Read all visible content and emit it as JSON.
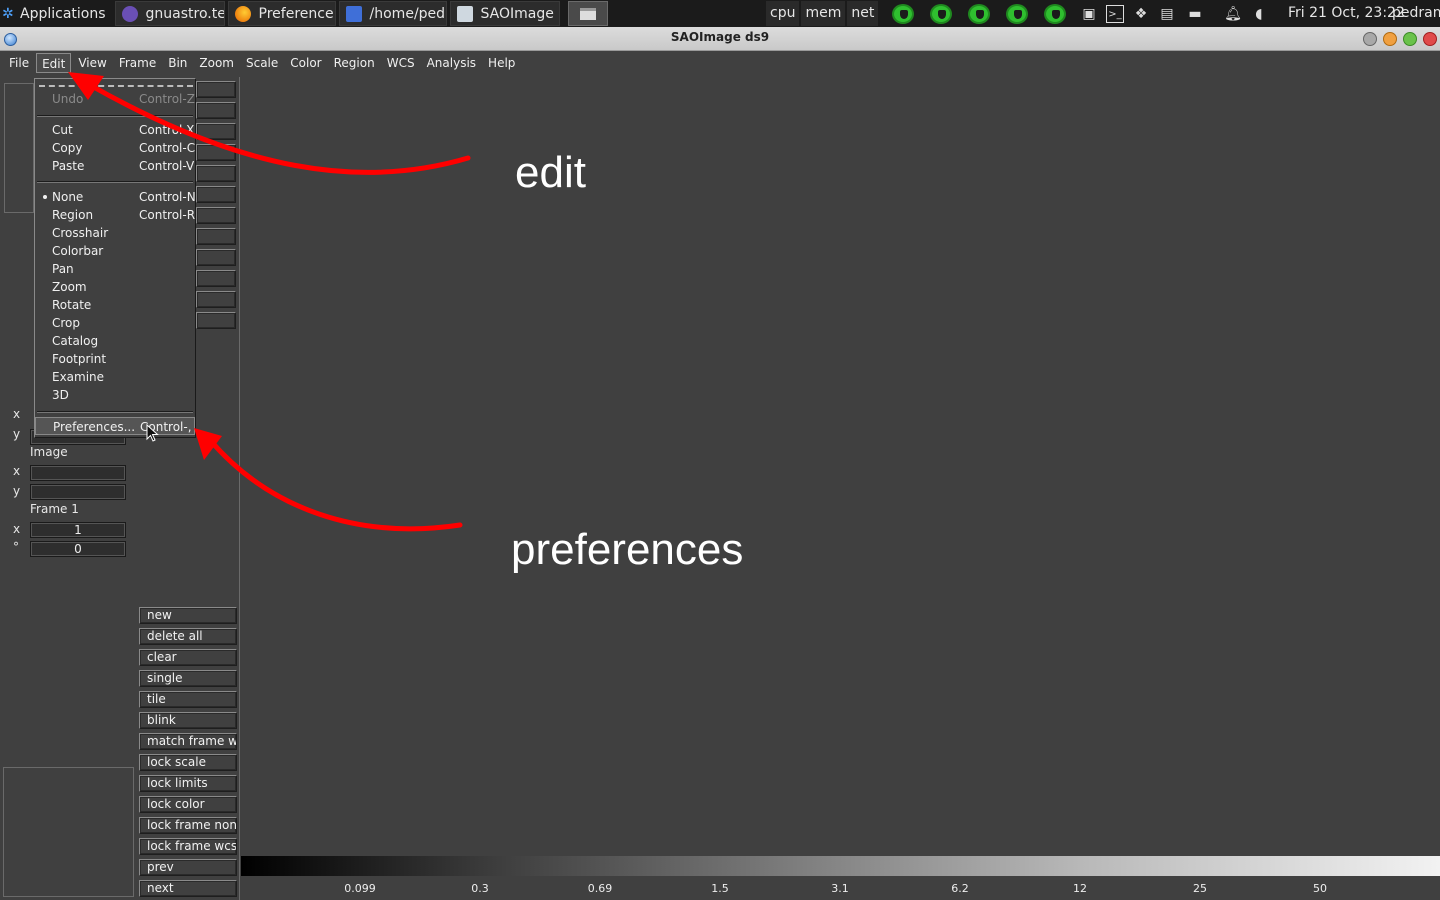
{
  "panel": {
    "applications": "Applications",
    "tasks": [
      {
        "label": "gnuastro.te...",
        "color": "#6a4fb5"
      },
      {
        "label": "Preference...",
        "color": "#e66000"
      },
      {
        "label": "/home/ped...",
        "color": "#3f6fd8"
      },
      {
        "label": "SAOImage ...",
        "color": "#cfd8e0"
      }
    ],
    "sysmon": [
      "cpu",
      "mem",
      "net"
    ],
    "clock": "Fri 21 Oct, 23:22",
    "user": "pedram"
  },
  "window": {
    "title": "SAOImage ds9"
  },
  "menubar": [
    "File",
    "Edit",
    "View",
    "Frame",
    "Bin",
    "Zoom",
    "Scale",
    "Color",
    "Region",
    "WCS",
    "Analysis",
    "Help"
  ],
  "dropdown": {
    "undo": {
      "label": "Undo",
      "accel": "Control-Z"
    },
    "cut": {
      "label": "Cut",
      "accel": "Control-X"
    },
    "copy": {
      "label": "Copy",
      "accel": "Control-C"
    },
    "paste": {
      "label": "Paste",
      "accel": "Control-V"
    },
    "modes": [
      {
        "label": "None",
        "accel": "Control-N"
      },
      {
        "label": "Region",
        "accel": "Control-R"
      },
      {
        "label": "Crosshair",
        "accel": ""
      },
      {
        "label": "Colorbar",
        "accel": ""
      },
      {
        "label": "Pan",
        "accel": ""
      },
      {
        "label": "Zoom",
        "accel": ""
      },
      {
        "label": "Rotate",
        "accel": ""
      },
      {
        "label": "Crop",
        "accel": ""
      },
      {
        "label": "Catalog",
        "accel": ""
      },
      {
        "label": "Footprint",
        "accel": ""
      },
      {
        "label": "Examine",
        "accel": ""
      },
      {
        "label": "3D",
        "accel": ""
      }
    ],
    "preferences": {
      "label": "Preferences...",
      "accel": "Control-,"
    }
  },
  "info": {
    "x_label": "x",
    "y_label": "y",
    "image_label": "Image",
    "frame_label": "Frame 1",
    "zoom_value": "1",
    "angle_label": "°",
    "angle_value": "0"
  },
  "buttons": [
    "new",
    "delete all",
    "clear",
    "single",
    "tile",
    "blink",
    "match frame wc",
    "lock scale",
    "lock limits",
    "lock color",
    "lock frame none",
    "lock frame wcs",
    "prev",
    "next"
  ],
  "colorbar_ticks": [
    "0.099",
    "0.3",
    "0.69",
    "1.5",
    "3.1",
    "6.2",
    "12",
    "25",
    "50"
  ],
  "annotations": {
    "edit": "edit",
    "preferences": "preferences"
  }
}
